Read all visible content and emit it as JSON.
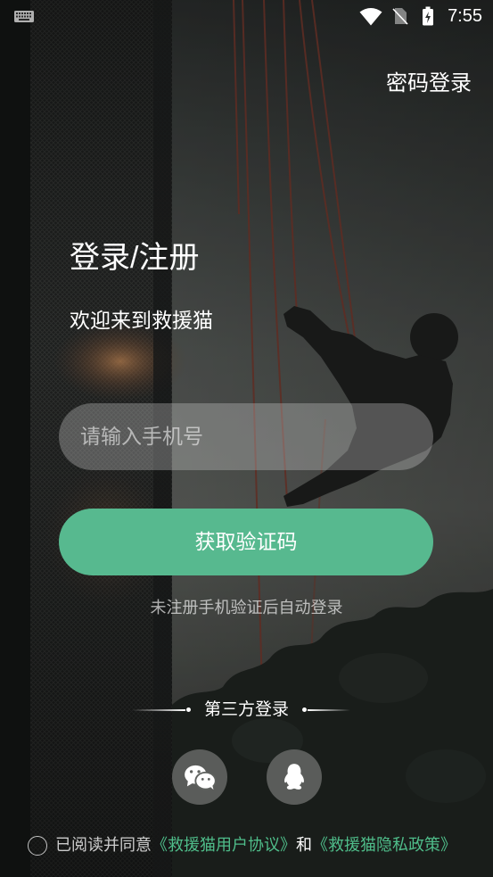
{
  "status_bar": {
    "time": "7:55",
    "icons": [
      "keyboard-icon",
      "wifi-icon",
      "no-sim-icon",
      "battery-charging-icon"
    ]
  },
  "header": {
    "password_login": "密码登录"
  },
  "main": {
    "title": "登录/注册",
    "subtitle": "欢迎来到救援猫"
  },
  "phone_input": {
    "placeholder": "请输入手机号",
    "value": ""
  },
  "get_code_button": {
    "label": "获取验证码"
  },
  "hint": "未注册手机验证后自动登录",
  "third_party": {
    "label": "第三方登录",
    "providers": [
      {
        "icon": "wechat-icon"
      },
      {
        "icon": "qq-icon"
      }
    ]
  },
  "agreement": {
    "checked": false,
    "prefix": "已阅读并同意",
    "user_agreement": "《救援猫用户协议》",
    "conjunction": "和",
    "privacy_policy": "《救援猫隐私政策》"
  },
  "colors": {
    "accent": "#57b98f",
    "link": "#4fbd8a",
    "text": "#ffffff"
  }
}
